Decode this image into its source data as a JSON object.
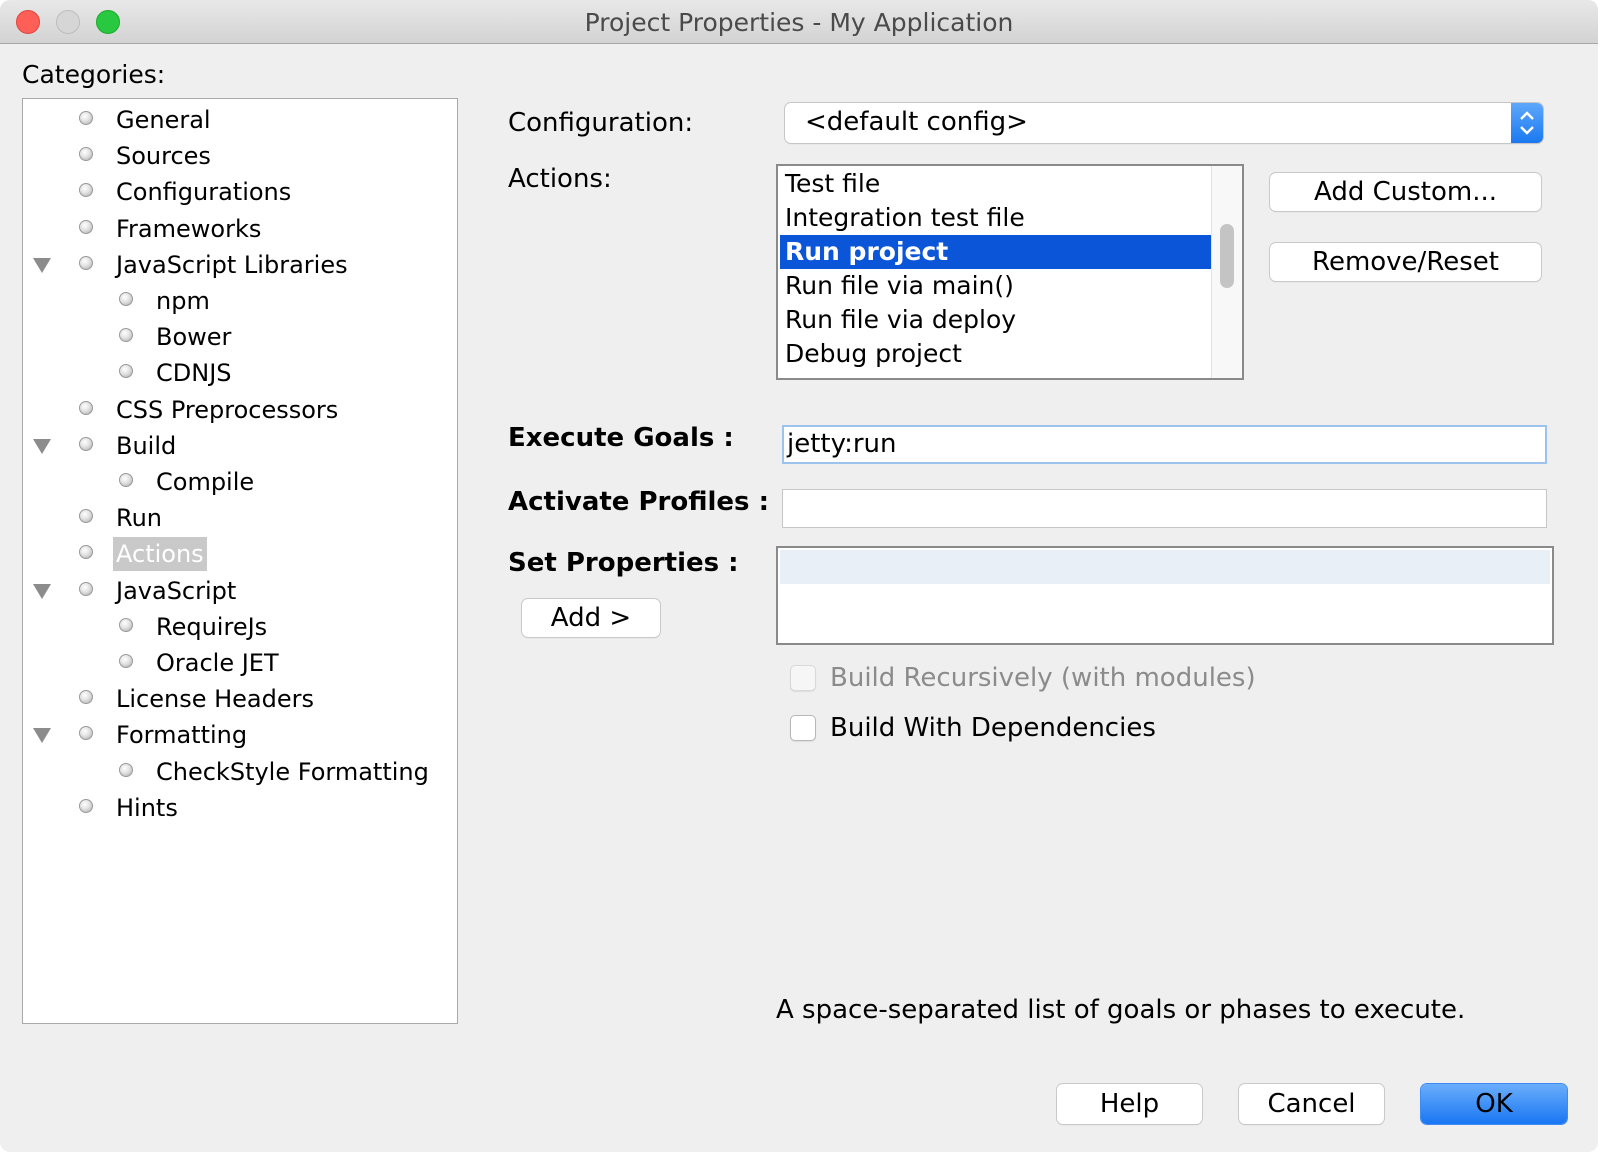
{
  "window": {
    "title": "Project Properties - My Application"
  },
  "categories": {
    "label": "Categories:",
    "selected": "Actions",
    "items": [
      {
        "label": "General",
        "level": 0,
        "expanded": false
      },
      {
        "label": "Sources",
        "level": 0,
        "expanded": false
      },
      {
        "label": "Configurations",
        "level": 0,
        "expanded": false
      },
      {
        "label": "Frameworks",
        "level": 0,
        "expanded": false
      },
      {
        "label": "JavaScript Libraries",
        "level": 0,
        "expanded": true
      },
      {
        "label": "npm",
        "level": 1,
        "expanded": false
      },
      {
        "label": "Bower",
        "level": 1,
        "expanded": false
      },
      {
        "label": "CDNJS",
        "level": 1,
        "expanded": false
      },
      {
        "label": "CSS Preprocessors",
        "level": 0,
        "expanded": false
      },
      {
        "label": "Build",
        "level": 0,
        "expanded": true
      },
      {
        "label": "Compile",
        "level": 1,
        "expanded": false
      },
      {
        "label": "Run",
        "level": 0,
        "expanded": false
      },
      {
        "label": "Actions",
        "level": 0,
        "expanded": false,
        "selected": true
      },
      {
        "label": "JavaScript",
        "level": 0,
        "expanded": true
      },
      {
        "label": "RequireJs",
        "level": 1,
        "expanded": false
      },
      {
        "label": "Oracle JET",
        "level": 1,
        "expanded": false
      },
      {
        "label": "License Headers",
        "level": 0,
        "expanded": false
      },
      {
        "label": "Formatting",
        "level": 0,
        "expanded": true
      },
      {
        "label": "CheckStyle Formatting",
        "level": 1,
        "expanded": false
      },
      {
        "label": "Hints",
        "level": 0,
        "expanded": false
      }
    ]
  },
  "form": {
    "configuration_label": "Configuration:",
    "configuration_value": "<default config>",
    "actions_label": "Actions:",
    "actions": [
      {
        "label": "Test file",
        "selected": false
      },
      {
        "label": "Integration test file",
        "selected": false
      },
      {
        "label": "Run project",
        "selected": true
      },
      {
        "label": "Run file via main()",
        "selected": false
      },
      {
        "label": "Run file via deploy",
        "selected": false
      },
      {
        "label": "Debug project",
        "selected": false
      }
    ],
    "add_custom_label": "Add Custom...",
    "remove_reset_label": "Remove/Reset",
    "execute_goals_label": "Execute Goals :",
    "execute_goals_value": "jetty:run",
    "activate_profiles_label": "Activate Profiles :",
    "activate_profiles_value": "",
    "set_properties_label": "Set Properties :",
    "add_label": "Add >",
    "build_recursively_label": "Build Recursively (with modules)",
    "build_recursively_checked": false,
    "build_recursively_enabled": false,
    "build_with_deps_label": "Build With Dependencies",
    "build_with_deps_checked": false,
    "hint": "A space-separated list of goals or phases to execute."
  },
  "footer": {
    "help_label": "Help",
    "cancel_label": "Cancel",
    "ok_label": "OK"
  },
  "colors": {
    "selection_blue": "#0b55d9",
    "primary_button": "#1976f2",
    "tree_selection": "#c9c9c9"
  }
}
